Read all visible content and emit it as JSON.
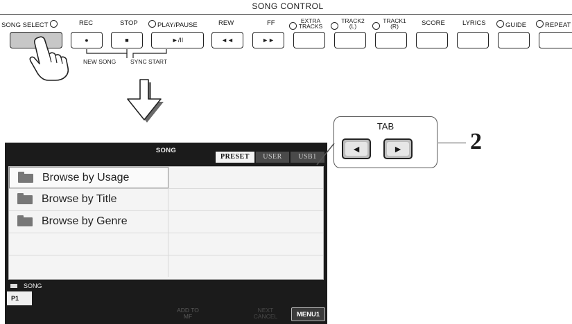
{
  "panel": {
    "title": "SONG CONTROL",
    "buttons": {
      "song_select": "SONG SELECT",
      "rec": "REC",
      "rec_symbol": "●",
      "stop": "STOP",
      "stop_symbol": "■",
      "play_pause": "PLAY/PAUSE",
      "play_pause_symbol": "►/II",
      "rew": "REW",
      "rew_symbol": "◄◄",
      "ff": "FF",
      "ff_symbol": "►►",
      "extra_tracks_1": "EXTRA",
      "extra_tracks_2": "TRACKS",
      "track2_1": "TRACK2",
      "track2_2": "(L)",
      "track1_1": "TRACK1",
      "track1_2": "(R)",
      "score": "SCORE",
      "lyrics": "LYRICS",
      "guide": "GUIDE",
      "repeat": "REPEAT"
    },
    "sublabels": {
      "new_song": "NEW SONG",
      "sync_start": "SYNC START"
    }
  },
  "screen": {
    "title": "SONG",
    "tabs": [
      "PRESET",
      "USER",
      "USB1"
    ],
    "active_tab": "PRESET",
    "rows": [
      "Browse by Usage",
      "Browse by Title",
      "Browse by Genre",
      "",
      ""
    ],
    "path": "SONG",
    "page": "P1",
    "soft_buttons": {
      "add_to_mf_1": "ADD TO",
      "add_to_mf_2": "MF",
      "next_cancel_1": "NEXT",
      "next_cancel_2": "CANCEL",
      "menu1": "MENU1"
    }
  },
  "callout": {
    "tab_label": "TAB",
    "left_symbol": "◄",
    "right_symbol": "►",
    "step_number": "2"
  },
  "colors": {
    "screen_bg": "#1b1b1b",
    "list_bg": "#f4f4f4",
    "selected_button": "#c7c7c7",
    "tab_button": "#bdbdbd"
  },
  "icons": [
    "hand-pointer-icon",
    "down-arrow-icon",
    "folder-icon",
    "led-icon"
  ]
}
